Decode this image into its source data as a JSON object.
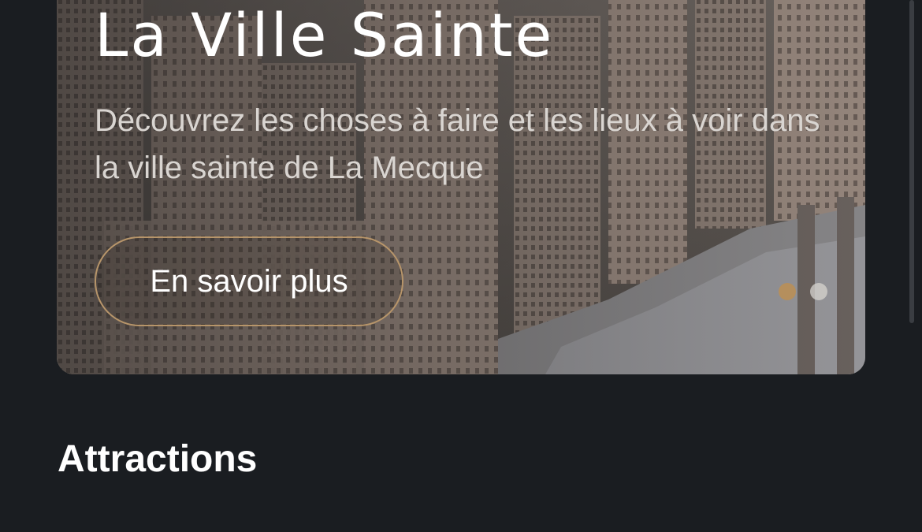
{
  "hero": {
    "title": "La Ville Sainte",
    "subtitle": "Découvrez les choses à faire et les lieux à voir dans la ville sainte de La Mecque",
    "cta_label": "En savoir plus",
    "carousel": {
      "count": 2,
      "active_index": 0
    }
  },
  "sections": {
    "attractions_title": "Attractions"
  },
  "colors": {
    "background": "#1a1d21",
    "accent": "#b58f5d",
    "text": "#ffffff"
  }
}
